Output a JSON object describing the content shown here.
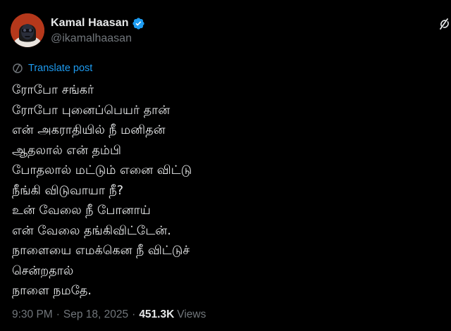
{
  "author": {
    "display_name": "Kamal Haasan",
    "handle": "@ikamalhaasan",
    "verified": true,
    "avatar_icon": "profile-avatar",
    "verified_icon": "verified-badge-icon"
  },
  "translate": {
    "label": "Translate post",
    "icon": "translate-icon"
  },
  "post": {
    "lines": [
      "ரோபோ சங்கர்",
      "ரோபோ புனைப்பெயர் தான்",
      "என் அகராதியில் நீ மனிதன்",
      "ஆதலால் என் தம்பி",
      "போதலால் மட்டும் எனை விட்டு",
      "நீங்கி விடுவாயா நீ?",
      "உன் வேலை நீ போனாய்",
      "என் வேலை தங்கிவிட்டேன்.",
      "நாளையை எமக்கென நீ விட்டுச்",
      "சென்றதால்",
      "நாளை நமதே."
    ]
  },
  "meta": {
    "time": "9:30 PM",
    "separator": "·",
    "date": "Sep 18, 2025",
    "views_count": "451.3K",
    "views_label": "Views"
  },
  "colors": {
    "background": "#000000",
    "text": "#e7e9ea",
    "secondary": "#71767b",
    "accent": "#1d9bf0"
  }
}
